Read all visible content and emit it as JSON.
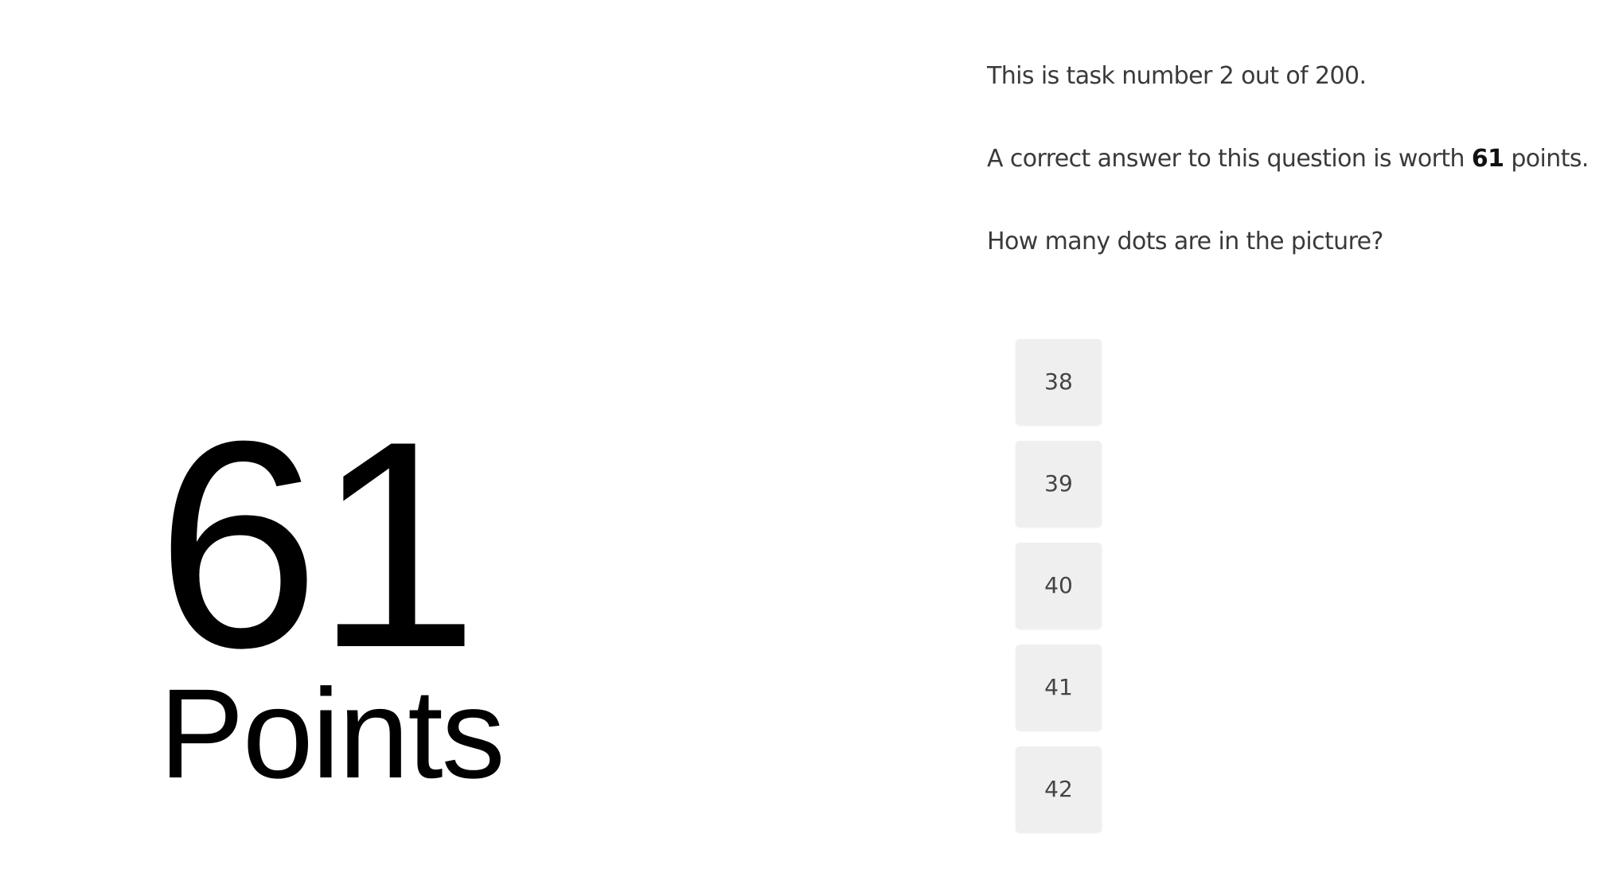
{
  "score": {
    "value": "61",
    "label": "Points"
  },
  "task": {
    "counter_text": "This is task number 2 out of 200.",
    "worth_prefix": "A correct answer to this question is worth ",
    "worth_value": "61",
    "worth_suffix": " points.",
    "question": "How many dots are in the picture?"
  },
  "answers": [
    {
      "label": "38"
    },
    {
      "label": "39"
    },
    {
      "label": "40"
    },
    {
      "label": "41"
    },
    {
      "label": "42"
    }
  ],
  "colors": {
    "background": "#ffffff",
    "button_bg": "#efefef",
    "text": "#3a3a3a",
    "score_text": "#000000"
  }
}
